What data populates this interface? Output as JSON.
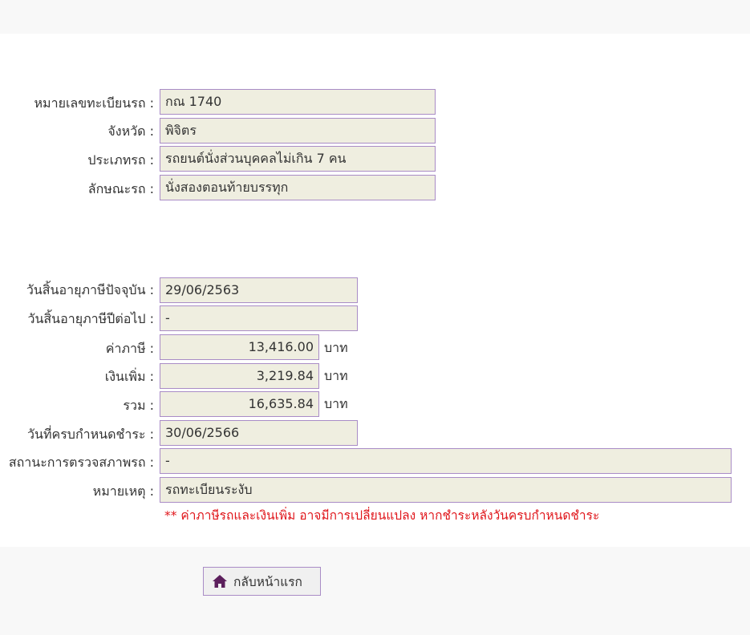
{
  "vehicle": {
    "plate_label": "หมายเลขทะเบียนรถ :",
    "plate_value": "กณ 1740",
    "province_label": "จังหวัด :",
    "province_value": "พิจิตร",
    "type_label": "ประเภทรถ :",
    "type_value": "รถยนต์นั่งส่วนบุคคลไม่เกิน 7 คน",
    "body_label": "ลักษณะรถ :",
    "body_value": "นั่งสองตอนท้ายบรรทุก"
  },
  "tax": {
    "current_expiry_label": "วันสิ้นอายุภาษีปัจจุบัน :",
    "current_expiry_value": "29/06/2563",
    "next_expiry_label": "วันสิ้นอายุภาษีปีต่อไป :",
    "next_expiry_value": "-",
    "tax_amount_label": "ค่าภาษี :",
    "tax_amount_value": "13,416.00",
    "surcharge_label": "เงินเพิ่ม :",
    "surcharge_value": "3,219.84",
    "total_label": "รวม :",
    "total_value": "16,635.84",
    "currency_unit": "บาท",
    "due_date_label": "วันที่ครบกำหนดชำระ :",
    "due_date_value": "30/06/2566",
    "inspection_label": "สถานะการตรวจสภาพรถ :",
    "inspection_value": "-",
    "remark_label": "หมายเหตุ :",
    "remark_value": "รถทะเบียนระงับ"
  },
  "notice": "** ค่าภาษีรถและเงินเพิ่ม อาจมีการเปลี่ยนแปลง หากชำระหลังวันครบกำหนดชำระ",
  "actions": {
    "home_label": "กลับหน้าแรก",
    "home_icon": "home-icon"
  },
  "colors": {
    "field_bg": "#efeee0",
    "field_border": "#a98cc6",
    "notice_text": "#e0161b",
    "icon": "#5c1f5c"
  }
}
